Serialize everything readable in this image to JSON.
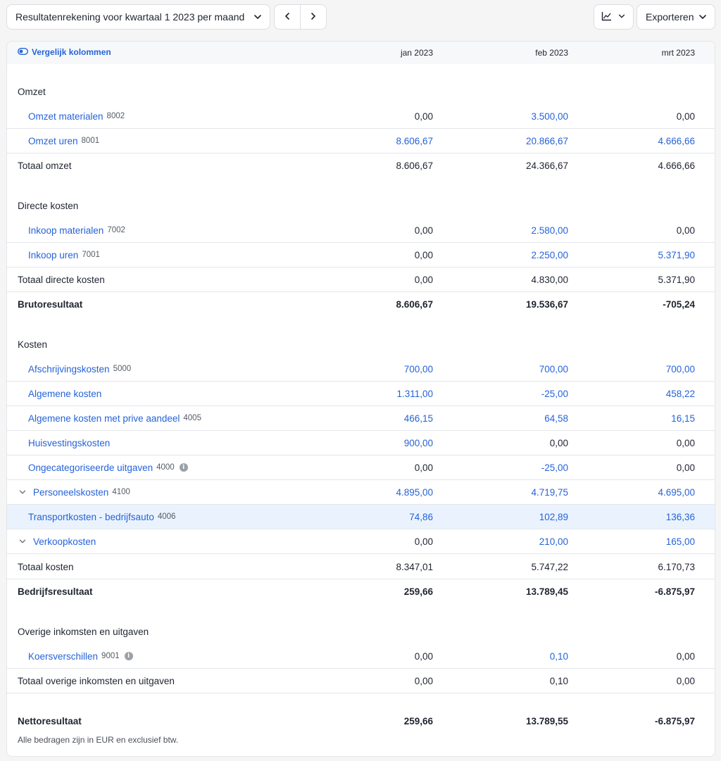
{
  "toolbar": {
    "period_label": "Resultatenrekening voor kwartaal 1 2023 per maand",
    "export_label": "Exporteren"
  },
  "header": {
    "compare_label": "Vergelijk kolommen",
    "columns": [
      "jan 2023",
      "feb 2023",
      "mrt 2023"
    ]
  },
  "sections": {
    "omzet": {
      "title": "Omzet",
      "rows": [
        {
          "label": "Omzet materialen",
          "code": "8002",
          "values": [
            "0,00",
            "3.500,00",
            "0,00"
          ]
        },
        {
          "label": "Omzet uren",
          "code": "8001",
          "values": [
            "8.606,67",
            "20.866,67",
            "4.666,66"
          ]
        }
      ],
      "total": {
        "label": "Totaal omzet",
        "values": [
          "8.606,67",
          "24.366,67",
          "4.666,66"
        ]
      }
    },
    "directe_kosten": {
      "title": "Directe kosten",
      "rows": [
        {
          "label": "Inkoop materialen",
          "code": "7002",
          "values": [
            "0,00",
            "2.580,00",
            "0,00"
          ]
        },
        {
          "label": "Inkoop uren",
          "code": "7001",
          "values": [
            "0,00",
            "2.250,00",
            "5.371,90"
          ]
        }
      ],
      "total": {
        "label": "Totaal directe kosten",
        "values": [
          "0,00",
          "4.830,00",
          "5.371,90"
        ]
      }
    },
    "brutoresultaat": {
      "label": "Brutoresultaat",
      "values": [
        "8.606,67",
        "19.536,67",
        "-705,24"
      ]
    },
    "kosten": {
      "title": "Kosten",
      "rows": [
        {
          "label": "Afschrijvingskosten",
          "code": "5000",
          "values": [
            "700,00",
            "700,00",
            "700,00"
          ]
        },
        {
          "label": "Algemene kosten",
          "code": "",
          "values": [
            "1.311,00",
            "-25,00",
            "458,22"
          ]
        },
        {
          "label": "Algemene kosten met prive aandeel",
          "code": "4005",
          "values": [
            "466,15",
            "64,58",
            "16,15"
          ]
        },
        {
          "label": "Huisvestingskosten",
          "code": "",
          "values": [
            "900,00",
            "0,00",
            "0,00"
          ]
        },
        {
          "label": "Ongecategoriseerde uitgaven",
          "code": "4000",
          "values": [
            "0,00",
            "-25,00",
            "0,00"
          ]
        },
        {
          "label": "Personeelskosten",
          "code": "4100",
          "values": [
            "4.895,00",
            "4.719,75",
            "4.695,00"
          ]
        },
        {
          "label": "Transportkosten - bedrijfsauto",
          "code": "4006",
          "values": [
            "74,86",
            "102,89",
            "136,36"
          ]
        },
        {
          "label": "Verkoopkosten",
          "code": "",
          "values": [
            "0,00",
            "210,00",
            "165,00"
          ]
        }
      ],
      "total": {
        "label": "Totaal kosten",
        "values": [
          "8.347,01",
          "5.747,22",
          "6.170,73"
        ]
      }
    },
    "bedrijfsresultaat": {
      "label": "Bedrijfsresultaat",
      "values": [
        "259,66",
        "13.789,45",
        "-6.875,97"
      ]
    },
    "overige": {
      "title": "Overige inkomsten en uitgaven",
      "rows": [
        {
          "label": "Koersverschillen",
          "code": "9001",
          "values": [
            "0,00",
            "0,10",
            "0,00"
          ]
        }
      ],
      "total": {
        "label": "Totaal overige inkomsten en uitgaven",
        "values": [
          "0,00",
          "0,10",
          "0,00"
        ]
      }
    },
    "nettoresultaat": {
      "label": "Nettoresultaat",
      "values": [
        "259,66",
        "13.789,55",
        "-6.875,97"
      ]
    }
  },
  "footnote": "Alle bedragen zijn in EUR en exclusief btw.",
  "colors": {
    "link": "#2563d9",
    "highlight": "#eaf3fd"
  }
}
